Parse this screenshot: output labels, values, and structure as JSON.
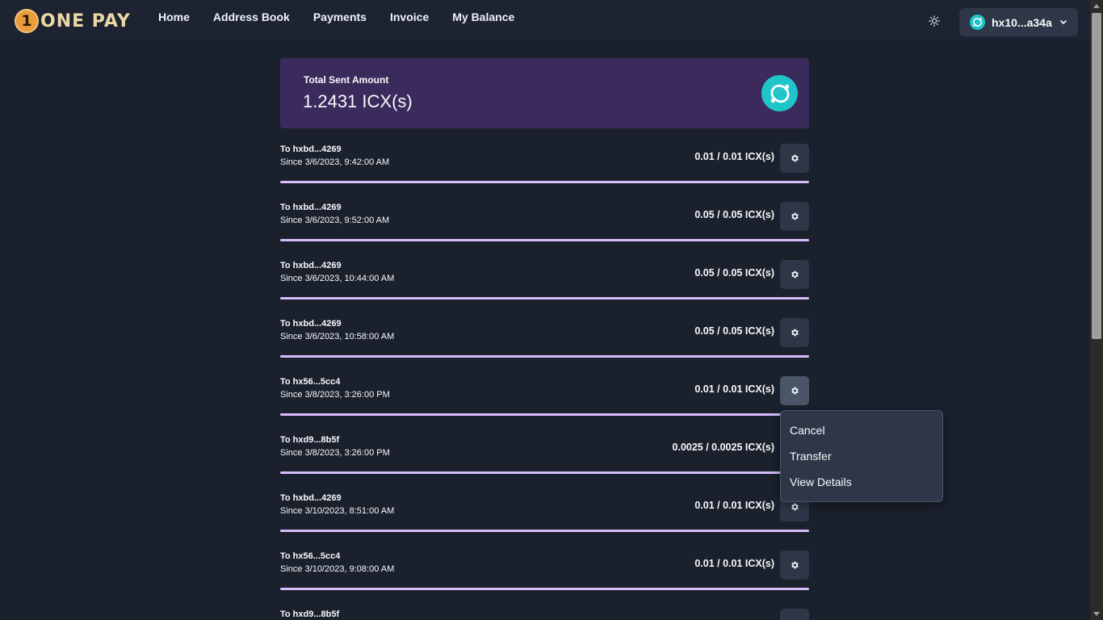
{
  "brand": {
    "name": "ONE PAY",
    "coin_glyph": "1"
  },
  "nav": [
    {
      "label": "Home"
    },
    {
      "label": "Address Book"
    },
    {
      "label": "Payments"
    },
    {
      "label": "Invoice"
    },
    {
      "label": "My Balance"
    }
  ],
  "wallet": {
    "address": "hx10...a34a"
  },
  "summary": {
    "label": "Total Sent Amount",
    "amount": "1.2431 ICX(s)"
  },
  "payments": [
    {
      "to": "To hxbd...4269",
      "since": "Since 3/6/2023, 9:42:00 AM",
      "amount": "0.01 / 0.01 ICX(s)",
      "progress": 1.0
    },
    {
      "to": "To hxbd...4269",
      "since": "Since 3/6/2023, 9:52:00 AM",
      "amount": "0.05 / 0.05 ICX(s)",
      "progress": 1.0
    },
    {
      "to": "To hxbd...4269",
      "since": "Since 3/6/2023, 10:44:00 AM",
      "amount": "0.05 / 0.05 ICX(s)",
      "progress": 1.0
    },
    {
      "to": "To hxbd...4269",
      "since": "Since 3/6/2023, 10:58:00 AM",
      "amount": "0.05 / 0.05 ICX(s)",
      "progress": 1.0
    },
    {
      "to": "To hx56...5cc4",
      "since": "Since 3/8/2023, 3:26:00 PM",
      "amount": "0.01 / 0.01 ICX(s)",
      "progress": 1.0
    },
    {
      "to": "To hxd9...8b5f",
      "since": "Since 3/8/2023, 3:26:00 PM",
      "amount": "0.0025 / 0.0025 ICX(s)",
      "progress": 1.0
    },
    {
      "to": "To hxbd...4269",
      "since": "Since 3/10/2023, 8:51:00 AM",
      "amount": "0.01 / 0.01 ICX(s)",
      "progress": 1.0
    },
    {
      "to": "To hx56...5cc4",
      "since": "Since 3/10/2023, 9:08:00 AM",
      "amount": "0.01 / 0.01 ICX(s)",
      "progress": 1.0
    },
    {
      "to": "To hxd9...8b5f",
      "since": "",
      "amount": "",
      "progress": 1.0
    }
  ],
  "menu": {
    "items": [
      {
        "label": "Cancel"
      },
      {
        "label": "Transfer"
      },
      {
        "label": "View Details"
      }
    ]
  },
  "colors": {
    "background": "#1a202c",
    "summary_card": "#3b2b5d",
    "progress": "#d6bcfa",
    "icon_accent": "#1fc5c9",
    "brand_orange": "#e89c3c"
  }
}
